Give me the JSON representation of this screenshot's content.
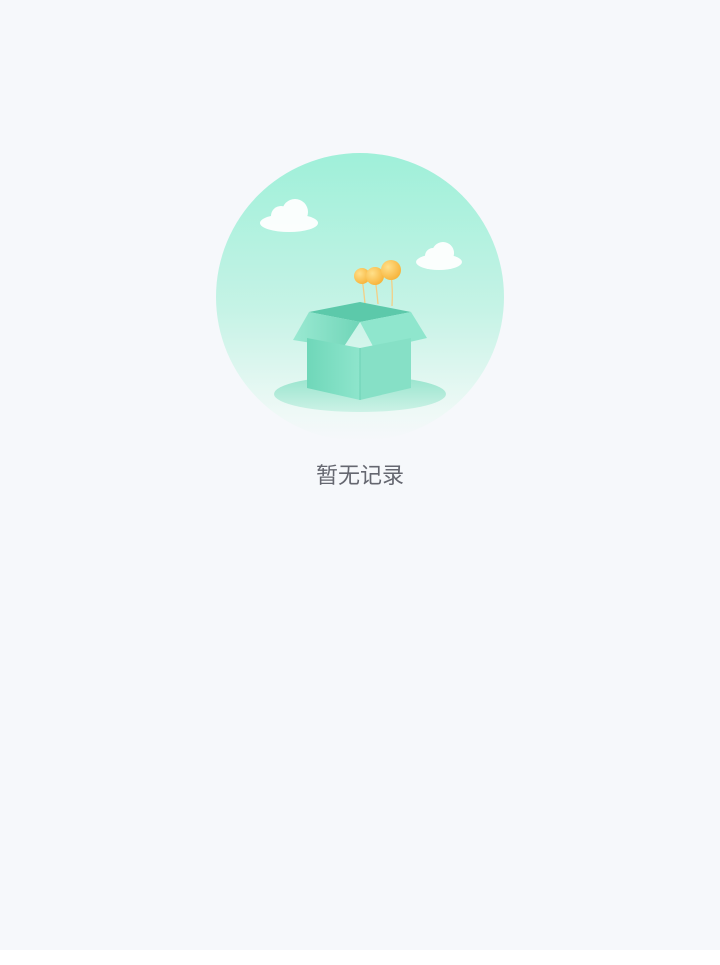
{
  "empty_state": {
    "message": "暂无记录",
    "illustration": "empty-box-with-balloons-icon"
  },
  "colors": {
    "background": "#f6f8fb",
    "circle_top": "#9fefd8",
    "box": "#79dcc0",
    "balloon": "#ffc24a",
    "text": "#656770"
  }
}
